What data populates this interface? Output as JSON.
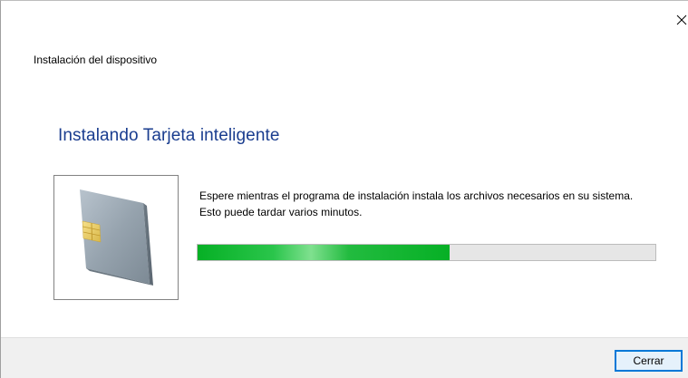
{
  "dialog": {
    "title": "Instalación del dispositivo",
    "close_icon": "close-icon"
  },
  "main": {
    "heading": "Instalando Tarjeta inteligente",
    "device_icon": "smart-card-icon",
    "message": "Espere mientras el programa de instalación instala los archivos necesarios en su sistema. Esto puede tardar varios minutos.",
    "progress_percent": 55,
    "progress_color": "#06b025"
  },
  "footer": {
    "close_button_label": "Cerrar"
  }
}
